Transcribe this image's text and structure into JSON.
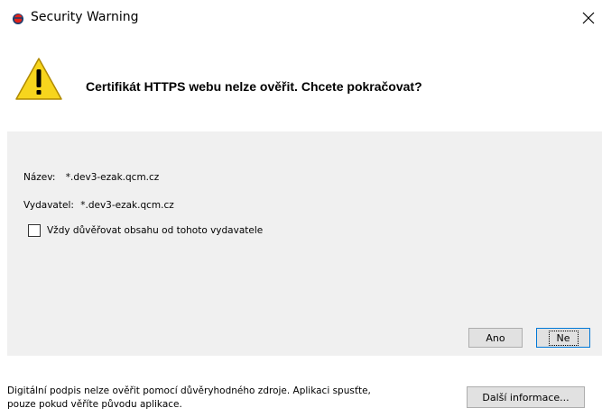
{
  "window": {
    "title": "Security Warning",
    "app_icon": "java-cup-icon",
    "close_icon": "close-icon"
  },
  "header": {
    "icon": "warning-icon",
    "message": "Certifikát HTTPS webu nelze ověřit. Chcete pokračovat?"
  },
  "details": {
    "name_label": "Název:",
    "name_value": "*.dev3-ezak.qcm.cz",
    "publisher_label": "Vydavatel:",
    "publisher_value": "*.dev3-ezak.qcm.cz",
    "trust_checkbox_label": "Vždy důvěřovat obsahu od tohoto vydavatele",
    "trust_checked": false
  },
  "buttons": {
    "yes_label": "Ano",
    "no_label": "Ne",
    "more_info_label": "Další informace..."
  },
  "footer": {
    "line1": "Digitální podpis nelze ověřit pomocí důvěryhodného zdroje. Aplikaci spusťte,",
    "line2": "pouze pokud věříte původu aplikace."
  },
  "colors": {
    "warning_yellow": "#f7d51d",
    "content_bg": "#f0f0f0",
    "default_button_border": "#0078d7"
  }
}
